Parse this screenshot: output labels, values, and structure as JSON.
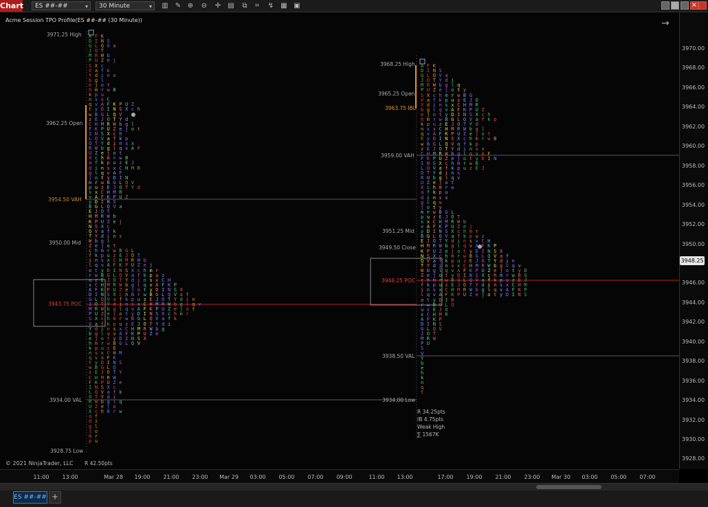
{
  "toolbar": {
    "chart_button": "Chart",
    "instrument": "ES ##-##",
    "interval": "30 Minute"
  },
  "chart": {
    "title": "Acme Session TPO Profile(ES ##-## (30 Minute))",
    "copyright": "© 2021 NinjaTrader, LLC",
    "f_button": "F",
    "current_price": "3948.25"
  },
  "yaxis": [
    "3970.00",
    "3968.00",
    "3966.00",
    "3964.00",
    "3962.00",
    "3960.00",
    "3958.00",
    "3956.00",
    "3954.00",
    "3952.00",
    "3950.00",
    "3948.00",
    "3946.00",
    "3944.00",
    "3942.00",
    "3940.00",
    "3938.00",
    "3936.00",
    "3934.00",
    "3932.00",
    "3930.00",
    "3928.00"
  ],
  "xaxis": [
    "11:00",
    "13:00",
    "Mar 28",
    "19:00",
    "21:00",
    "23:00",
    "Mar 29",
    "03:00",
    "05:00",
    "07:00",
    "09:00",
    "11:00",
    "13:00",
    "17:00",
    "19:00",
    "21:00",
    "23:00",
    "Mar 30",
    "03:00",
    "05:00",
    "07:00"
  ],
  "session1": {
    "high": "3971.25 High",
    "open": "3962.25 Open",
    "vah": "3954.50 VAH",
    "mid": "3950.00 Mid",
    "poc": "3943.75 POC",
    "val": "3934.00 VAL",
    "low": "3928.75 Low",
    "range": "R 42.50pts"
  },
  "session2": {
    "high": "3968.25 High",
    "open": "3965.25 Open",
    "ibl": "3963.75 IBL",
    "vah": "3959.00 VAH",
    "mid": "3951.25 Mid",
    "close": "3949.50 Close",
    "poc": "3946.25 POC",
    "val": "3938.50 VAL",
    "low": "3934.00 Low",
    "range": "R 34.25pts",
    "ib": "IB 4.75pts",
    "weak": "Weak High",
    "volume": "∑ 1567K"
  },
  "tabs": {
    "active": "ES ##-##",
    "add": "+"
  },
  "colors": {
    "accent": "#b01c1c",
    "ib_bar": "#e8922a",
    "poc_line": "#b3202a"
  }
}
